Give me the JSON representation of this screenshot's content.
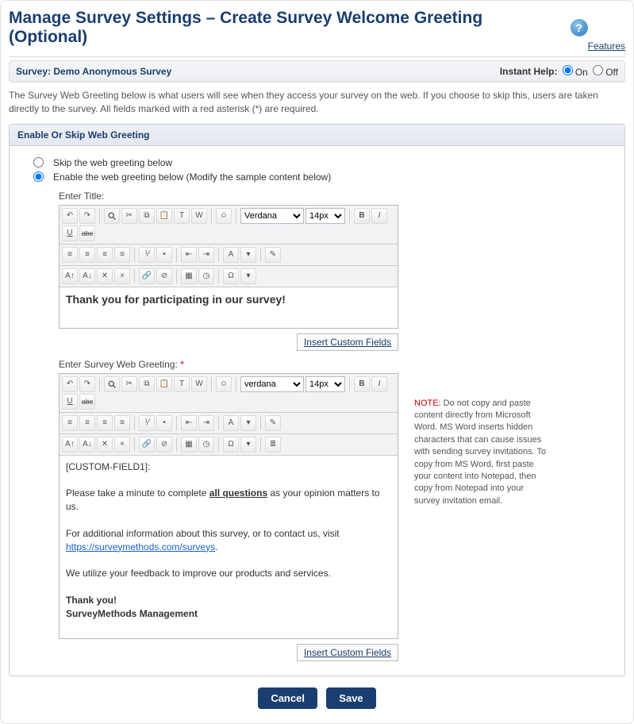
{
  "header": {
    "title": "Manage Survey Settings – Create Survey Welcome Greeting (Optional)",
    "features_link": "Features"
  },
  "subheader": {
    "survey_label": "Survey: Demo Anonymous Survey",
    "instant_help_label": "Instant Help:",
    "on_label": "On",
    "off_label": "Off",
    "instant_help_value": "on"
  },
  "intro": "The Survey Web Greeting below is what users will see when they access your survey on the web. If you choose to skip this, users are taken directly to the survey. All fields marked with a red asterisk (*) are required.",
  "section": {
    "heading": "Enable Or Skip Web Greeting",
    "skip_label": "Skip the web greeting below",
    "enable_label": "Enable the web greeting below (Modify the sample content below)",
    "selected": "enable"
  },
  "title_editor": {
    "label": "Enter Title:",
    "font_name": "Verdana",
    "font_size": "14px",
    "content_headline": "Thank you for participating in our survey!",
    "insert_link": "Insert Custom Fields"
  },
  "greeting_editor": {
    "label": "Enter Survey Web Greeting:",
    "font_name": "verdana",
    "font_size": "14px",
    "insert_link": "Insert Custom Fields",
    "content": {
      "custom_field_token": "[CUSTOM-FIELD1]:",
      "line1_pre": "Please take a minute to complete ",
      "line1_underline": "all questions",
      "line1_post": " as your opinion matters to us.",
      "line2": "For additional information about this survey, or to contact us, visit ",
      "link_text": "https://surveymethods.com/surveys",
      "line2_post": ".",
      "line3": "We utilize your feedback to improve our products and services.",
      "thank_you": "Thank you!",
      "signature": "SurveyMethods Management"
    }
  },
  "note": {
    "label": "NOTE:",
    "text": " Do not copy and paste content directly from Microsoft Word. MS Word inserts hidden characters that can cause issues with sending survey invitations. To copy from MS Word, first paste your content into Notepad, then copy from Notepad into your survey invitation email."
  },
  "buttons": {
    "cancel": "Cancel",
    "save": "Save"
  },
  "toolbar_icons": {
    "undo": "↶",
    "redo": "↷",
    "find": "🔍",
    "cut": "✂",
    "copy": "📄",
    "paste": "📋",
    "paste_text": "📋",
    "paste_word": "W",
    "bold": "B",
    "italic": "I",
    "underline": "U",
    "strike": "abc"
  }
}
